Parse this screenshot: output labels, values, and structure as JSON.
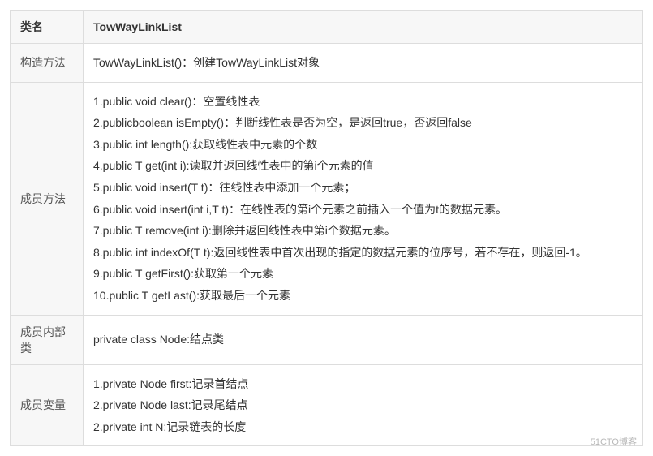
{
  "header": {
    "label": "类名",
    "value": "TowWayLinkList"
  },
  "rows": [
    {
      "label": "构造方法",
      "lines": [
        "TowWayLinkList()：创建TowWayLinkList对象"
      ]
    },
    {
      "label": "成员方法",
      "lines": [
        "1.public void clear()：空置线性表",
        "2.publicboolean isEmpty()：判断线性表是否为空，是返回true，否返回false",
        "3.public int length():获取线性表中元素的个数",
        "4.public T get(int i):读取并返回线性表中的第i个元素的值",
        "5.public void insert(T t)：往线性表中添加一个元素；",
        "6.public void insert(int i,T t)：在线性表的第i个元素之前插入一个值为t的数据元素。",
        "7.public T remove(int i):删除并返回线性表中第i个数据元素。",
        "8.public int indexOf(T t):返回线性表中首次出现的指定的数据元素的位序号，若不存在，则返回-1。",
        "9.public T getFirst():获取第一个元素",
        "10.public T getLast():获取最后一个元素"
      ]
    },
    {
      "label": "成员内部类",
      "lines": [
        "private class Node:结点类"
      ]
    },
    {
      "label": "成员变量",
      "lines": [
        "1.private Node first:记录首结点",
        "2.private Node last:记录尾结点",
        "2.private int N:记录链表的长度"
      ]
    }
  ],
  "watermark": "51CTO博客"
}
